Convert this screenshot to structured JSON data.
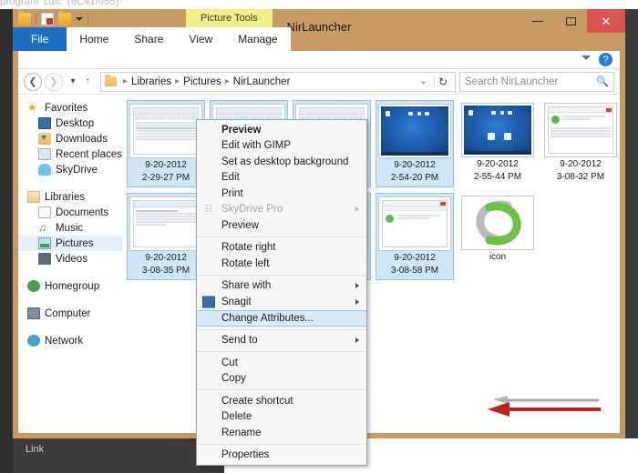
{
  "backdrop": {
    "top_text": "program 'calc' (6C41/055)",
    "link_label": "Link"
  },
  "window": {
    "title": "NirLauncher",
    "caption": {
      "minimize": "minimize-button",
      "maximize": "maximize-button",
      "close": "✕"
    },
    "quick_access": [
      "folder-icon",
      "save-icon",
      "folder-icon",
      "customize-caret"
    ]
  },
  "ribbon": {
    "contextual_tab_label": "Picture Tools",
    "tabs": [
      {
        "label": "File",
        "selected": true
      },
      {
        "label": "Home",
        "selected": false
      },
      {
        "label": "Share",
        "selected": false
      },
      {
        "label": "View",
        "selected": false
      },
      {
        "label": "Manage",
        "selected": false
      }
    ],
    "help_glyph": "?",
    "collapse_icon": "chevron-down-icon"
  },
  "address_bar": {
    "back": "◀",
    "forward": "▶",
    "recent_caret": "▾",
    "up": "↑",
    "breadcrumbs": [
      "Libraries",
      "Pictures",
      "NirLauncher"
    ],
    "separator": "▸",
    "dropdown_caret": "⌄",
    "refresh": "↻"
  },
  "search": {
    "placeholder": "Search NirLauncher",
    "icon": "search-icon"
  },
  "sidebar": {
    "groups": [
      {
        "header": {
          "label": "Favorites",
          "icon": "star-icon"
        },
        "items": [
          {
            "label": "Desktop",
            "icon": "desktop-icon",
            "selected": false
          },
          {
            "label": "Downloads",
            "icon": "downloads-icon",
            "selected": false
          },
          {
            "label": "Recent places",
            "icon": "recent-places-icon",
            "selected": false
          },
          {
            "label": "SkyDrive",
            "icon": "skydrive-icon",
            "selected": false
          }
        ]
      },
      {
        "header": {
          "label": "Libraries",
          "icon": "libraries-icon"
        },
        "items": [
          {
            "label": "Documents",
            "icon": "document-icon",
            "selected": false
          },
          {
            "label": "Music",
            "icon": "music-icon",
            "selected": false
          },
          {
            "label": "Pictures",
            "icon": "pictures-icon",
            "selected": true
          },
          {
            "label": "Videos",
            "icon": "videos-icon",
            "selected": false
          }
        ]
      },
      {
        "header": {
          "label": "Homegroup",
          "icon": "homegroup-icon"
        },
        "items": []
      },
      {
        "header": {
          "label": "Computer",
          "icon": "computer-icon"
        },
        "items": []
      },
      {
        "header": {
          "label": "Network",
          "icon": "network-icon"
        },
        "items": []
      }
    ]
  },
  "files": {
    "row1": [
      {
        "line1": "9-20-2012",
        "line2": "2-29-27 PM",
        "art": "app-window",
        "selected": true
      },
      {
        "line1": "",
        "line2": "",
        "art": "app-window",
        "selected": true
      },
      {
        "line1": "",
        "line2": "",
        "art": "app-window",
        "selected": true
      },
      {
        "line1": "9-20-2012",
        "line2": "2-54-20 PM",
        "art": "desktop",
        "selected": true
      },
      {
        "line1": "9-20-2012",
        "line2": "2-55-44 PM",
        "art": "desktop",
        "selected": false
      },
      {
        "line1": "9-20-2012",
        "line2": "3-08-32 PM",
        "art": "dialog",
        "selected": false
      }
    ],
    "row2": [
      {
        "line1": "9-20-2012",
        "line2": "3-08-35 PM",
        "art": "document",
        "selected": true
      },
      {
        "line1": "",
        "line2": "",
        "art": "app-window",
        "selected": true
      },
      {
        "line1": "",
        "line2": "",
        "art": "app-window",
        "selected": true
      },
      {
        "line1": "9-20-2012",
        "line2": "3-08-58 PM",
        "art": "dialog",
        "selected": true
      },
      {
        "line1": "icon",
        "line2": "",
        "art": "logo",
        "selected": false
      }
    ]
  },
  "context_menu": {
    "items": [
      {
        "label": "Preview",
        "style": "bold"
      },
      {
        "label": "Edit with GIMP",
        "style": "normal"
      },
      {
        "label": "Set as desktop background",
        "style": "normal"
      },
      {
        "label": "Edit",
        "style": "normal"
      },
      {
        "label": "Print",
        "style": "normal"
      },
      {
        "label": "SkyDrive Pro",
        "style": "disabled",
        "submenu": true,
        "icon": "skydrive-pro-icon"
      },
      {
        "label": "Preview",
        "style": "normal"
      },
      {
        "separator": true
      },
      {
        "label": "Rotate right",
        "style": "normal"
      },
      {
        "label": "Rotate left",
        "style": "normal"
      },
      {
        "separator": true
      },
      {
        "label": "Share with",
        "style": "normal",
        "submenu": true
      },
      {
        "label": "Snagit",
        "style": "normal",
        "submenu": true,
        "icon": "snagit-icon"
      },
      {
        "label": "Change Attributes...",
        "style": "highlight"
      },
      {
        "separator": true
      },
      {
        "label": "Send to",
        "style": "normal",
        "submenu": true
      },
      {
        "separator": true
      },
      {
        "label": "Cut",
        "style": "normal"
      },
      {
        "label": "Copy",
        "style": "normal"
      },
      {
        "separator": true
      },
      {
        "label": "Create shortcut",
        "style": "normal"
      },
      {
        "label": "Delete",
        "style": "normal"
      },
      {
        "label": "Rename",
        "style": "normal"
      },
      {
        "separator": true
      },
      {
        "label": "Properties",
        "style": "normal"
      }
    ]
  },
  "annotations": {
    "red_arrow": {
      "color": "#c0201e",
      "points_to": "Change Attributes..."
    },
    "gray_arrow": {
      "color": "#9a9a9a"
    }
  },
  "colors": {
    "window_chrome": "#c79b63",
    "file_tab": "#1e6fc4",
    "contextual_tab": "#f2f08a",
    "selection": "#cfe6f7",
    "menu_highlight": "#dbeaf8",
    "close_button": "#d9534f"
  }
}
